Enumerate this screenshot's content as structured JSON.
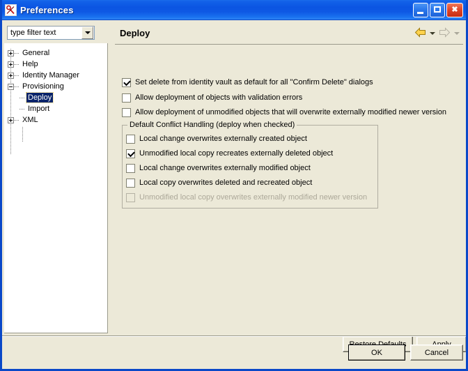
{
  "window": {
    "title": "Preferences",
    "icon": "preferences-icon",
    "minimize_label": "Minimize",
    "maximize_label": "Maximize",
    "close_label": "Close"
  },
  "sidebar": {
    "filter": {
      "value": "type filter text",
      "placeholder": "type filter text"
    },
    "items": [
      {
        "label": "General",
        "level": 0,
        "state": "collapsed",
        "selected": false
      },
      {
        "label": "Help",
        "level": 0,
        "state": "collapsed",
        "selected": false
      },
      {
        "label": "Identity Manager",
        "level": 0,
        "state": "collapsed",
        "selected": false
      },
      {
        "label": "Provisioning",
        "level": 0,
        "state": "expanded",
        "selected": false
      },
      {
        "label": "Deploy",
        "level": 1,
        "state": "leaf",
        "selected": true
      },
      {
        "label": "Import",
        "level": 1,
        "state": "leaf",
        "selected": false
      },
      {
        "label": "XML",
        "level": 0,
        "state": "collapsed",
        "selected": false
      }
    ]
  },
  "main": {
    "title": "Deploy",
    "nav": {
      "back_label": "Back",
      "back_enabled": true,
      "forward_label": "Forward",
      "forward_enabled": false
    },
    "options": [
      {
        "label": "Set delete from identity vault as default for all \"Confirm Delete\" dialogs",
        "checked": true,
        "enabled": true
      },
      {
        "label": "Allow deployment of objects with validation errors",
        "checked": false,
        "enabled": true
      },
      {
        "label": "Allow deployment of unmodified objects that will overwrite externally modified newer version",
        "checked": false,
        "enabled": true
      }
    ],
    "group": {
      "legend": "Default Conflict Handling (deploy when checked)",
      "options": [
        {
          "label": "Local change overwrites externally created object",
          "checked": false,
          "enabled": true
        },
        {
          "label": "Unmodified local copy recreates externally deleted object",
          "checked": true,
          "enabled": true
        },
        {
          "label": "Local change overwrites externally modified object",
          "checked": false,
          "enabled": true
        },
        {
          "label": "Local copy overwrites deleted and recreated object",
          "checked": false,
          "enabled": true
        },
        {
          "label": "Unmodified local copy overwrites externally modified newer version",
          "checked": false,
          "enabled": false
        }
      ]
    },
    "restore_defaults_label": "Restore Defaults",
    "restore_defaults_mnemonic": "D",
    "apply_label": "Apply",
    "apply_mnemonic": "A"
  },
  "footer": {
    "ok_label": "OK",
    "cancel_label": "Cancel",
    "default_button": "OK"
  },
  "colors": {
    "titlebar_blue": "#0b55e2",
    "window_border": "#0a48c8",
    "dialog_face": "#ece9d8",
    "selection_blue": "#0a246a",
    "disabled_text": "#aca899",
    "close_red": "#e0472a"
  }
}
